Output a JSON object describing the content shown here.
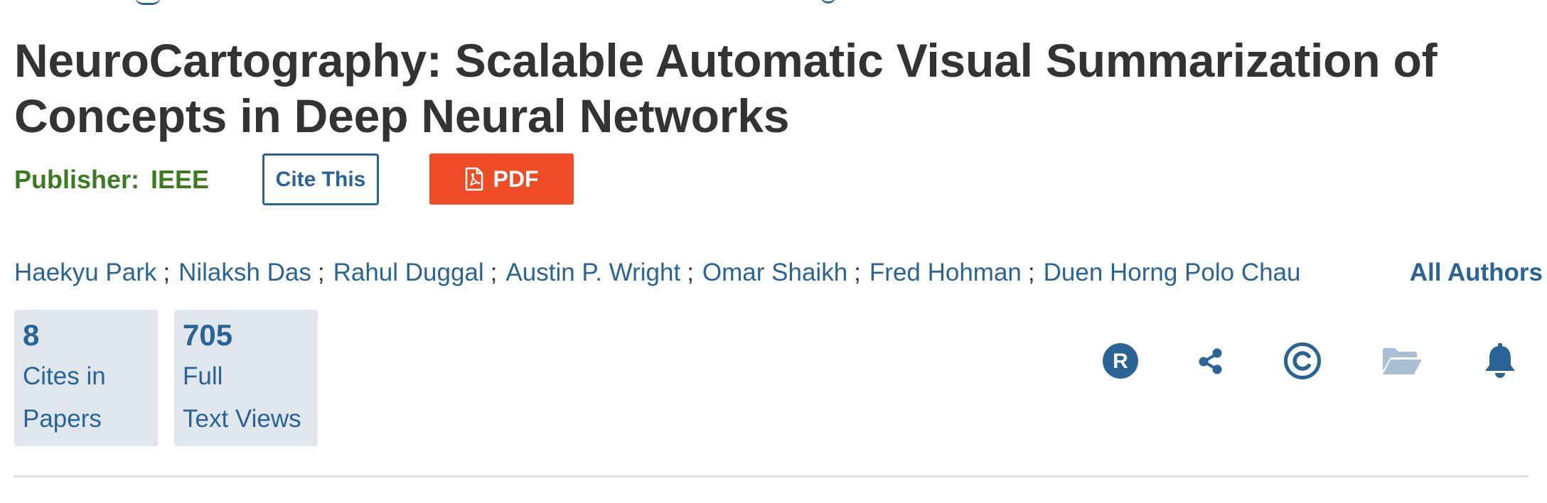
{
  "paper": {
    "title": "NeuroCartography: Scalable Automatic Visual Summarization of Concepts in Deep Neural Networks",
    "publisher_label": "Publisher:",
    "publisher_value": "IEEE"
  },
  "actions": {
    "cite_label": "Cite This",
    "pdf_label": "PDF"
  },
  "authors": {
    "list": [
      "Haekyu Park",
      "Nilaksh Das",
      "Rahul Duggal",
      "Austin P. Wright",
      "Omar Shaikh",
      "Fred Hohman",
      "Duen Horng Polo Chau"
    ],
    "separator": ";",
    "all_authors_label": "All Authors"
  },
  "metrics": [
    {
      "count": "8",
      "label": "Cites in\nPapers"
    },
    {
      "count": "705",
      "label": "Full\nText Views"
    }
  ],
  "toolbar_icons": [
    "rights-r-icon",
    "share-icon",
    "copyright-icon",
    "folder-icon",
    "bell-icon"
  ],
  "colors": {
    "title": "#333333",
    "link": "#2a6396",
    "publisher": "#3c7a1f",
    "pdf_button": "#ee4b27",
    "metric_bg": "#dfe6ec",
    "divider": "#dcdcdc"
  }
}
